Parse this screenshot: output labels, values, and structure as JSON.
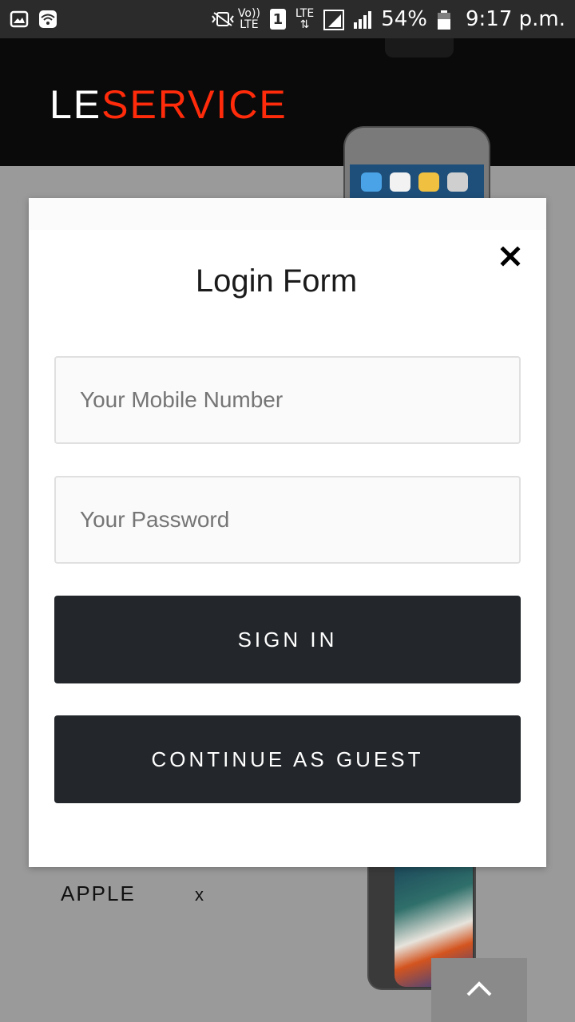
{
  "status_bar": {
    "volte_top": "Vo))",
    "volte_bottom": "LTE",
    "sim_slot": "1",
    "network_top": "LTE",
    "battery_percent": "54%",
    "time": "9:17 p.m.",
    "icons": [
      "gallery-icon",
      "wifi-icon",
      "vibrate-icon",
      "volte-icon",
      "sim-icon",
      "lte-signal-icon",
      "signal-icon",
      "battery-icon"
    ]
  },
  "header": {
    "brand_le": "LE",
    "brand_service": "SERVICE",
    "brand_colors": {
      "le": "#ffffff",
      "service": "#ff2b0a"
    }
  },
  "background": {
    "product_brand": "APPLE",
    "remove_label": "x"
  },
  "modal": {
    "title": "Login Form",
    "close_icon": "close-icon",
    "mobile_placeholder": "Your Mobile Number",
    "password_placeholder": "Your Password",
    "sign_in_label": "SIGN IN",
    "guest_label": "CONTINUE AS GUEST",
    "button_color": "#23272b"
  },
  "scroll_top": {
    "icon": "chevron-up-icon"
  }
}
